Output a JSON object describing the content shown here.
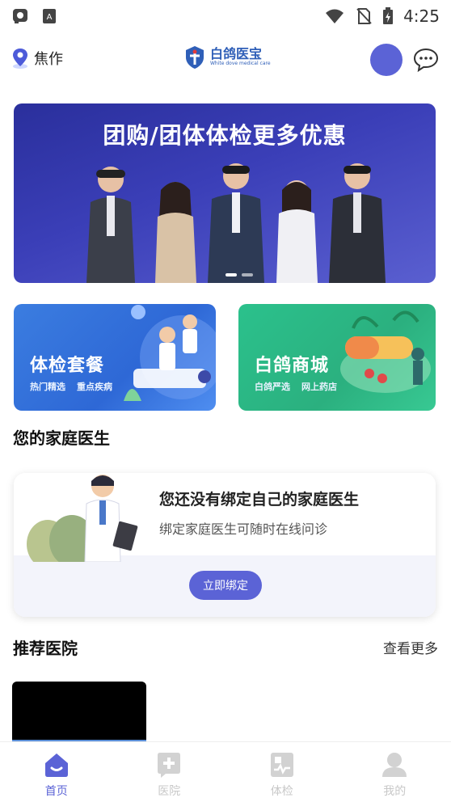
{
  "status_bar": {
    "time": "4:25",
    "left_icons": [
      "notification-icon",
      "accessibility-icon"
    ],
    "right_icons": [
      "wifi-icon",
      "no-sim-icon",
      "battery-icon"
    ]
  },
  "header": {
    "location": "焦作",
    "brand_name": "白鸽医宝",
    "brand_sub": "White dove medical care",
    "avatar_color": "#5b63d6"
  },
  "banner": {
    "title": "团购/团体体检更多优惠",
    "page_count": 2,
    "active_page": 1
  },
  "cards": {
    "exam": {
      "title": "体检套餐",
      "tags": [
        "热门精选",
        "重点疾病"
      ]
    },
    "mall": {
      "title": "白鸽商城",
      "tags": [
        "白鸽严选",
        "网上药店"
      ]
    }
  },
  "family_doctor": {
    "section_title": "您的家庭医生",
    "headline": "您还没有绑定自己的家庭医生",
    "description": "绑定家庭医生可随时在线问诊",
    "button_label": "立即绑定"
  },
  "hospitals": {
    "section_title": "推荐医院",
    "more_label": "查看更多"
  },
  "tab_bar": {
    "active_color": "#5b63d6",
    "inactive_color": "#c8c8c8",
    "tabs": [
      {
        "label": "首页",
        "icon": "home-icon",
        "active": true
      },
      {
        "label": "医院",
        "icon": "hospital-icon",
        "active": false
      },
      {
        "label": "体检",
        "icon": "checkup-icon",
        "active": false
      },
      {
        "label": "我的",
        "icon": "profile-icon",
        "active": false
      }
    ]
  }
}
